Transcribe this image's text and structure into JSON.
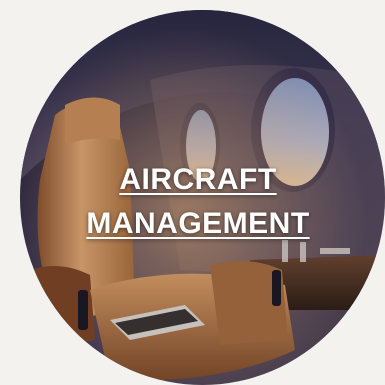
{
  "tile": {
    "title_line1": "AIRCRAFT",
    "title_line2": "MANAGEMENT"
  },
  "colors": {
    "page_background": "#f3f2ee",
    "text": "#ffffff",
    "cabin_dark": "#2e2c4e",
    "leather": "#c98b58"
  }
}
